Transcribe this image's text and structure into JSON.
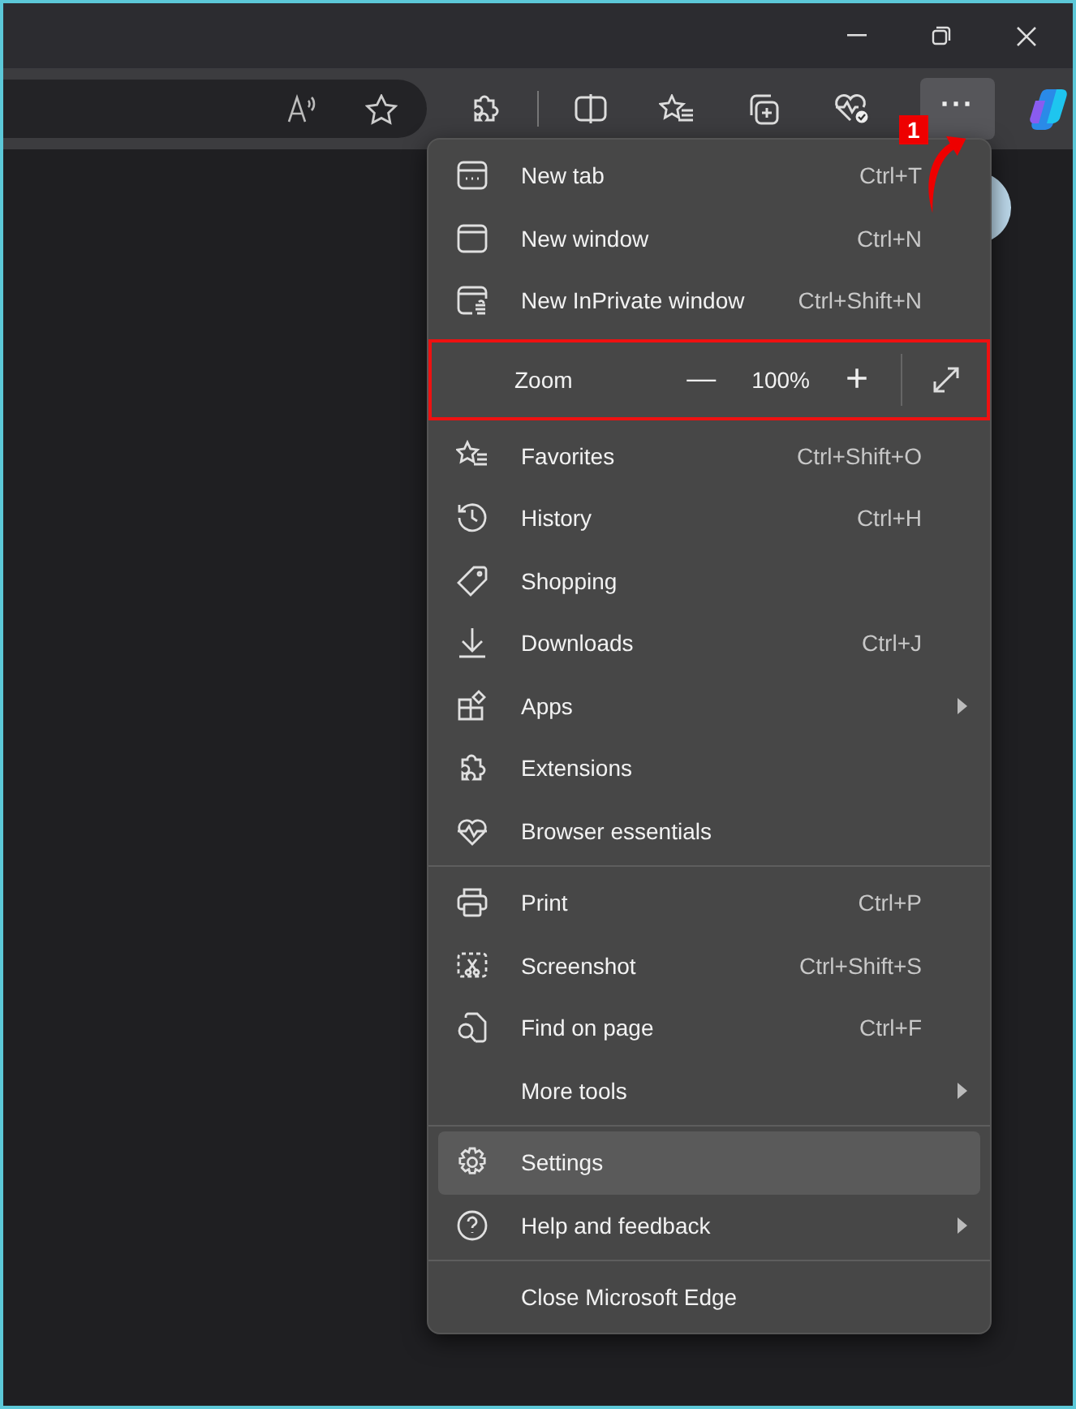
{
  "toolbar": {
    "more_button": {
      "label": "···",
      "active": true
    }
  },
  "menu": {
    "sections": [
      [
        {
          "kind": "item",
          "label": "New tab",
          "shortcut": "Ctrl+T",
          "has_submenu": false,
          "selected": false
        },
        {
          "kind": "item",
          "label": "New window",
          "shortcut": "Ctrl+N",
          "has_submenu": false,
          "selected": false
        },
        {
          "kind": "item",
          "label": "New InPrivate window",
          "shortcut": "Ctrl+Shift+N",
          "has_submenu": false,
          "selected": false
        },
        {
          "kind": "zoom",
          "label": "Zoom",
          "value": "100%",
          "minus": "—",
          "plus": "+",
          "outlined": true
        },
        {
          "kind": "item",
          "label": "Favorites",
          "shortcut": "Ctrl+Shift+O",
          "has_submenu": false,
          "selected": false
        },
        {
          "kind": "item",
          "label": "History",
          "shortcut": "Ctrl+H",
          "has_submenu": false,
          "selected": false
        },
        {
          "kind": "item",
          "label": "Shopping",
          "has_submenu": false,
          "selected": false
        },
        {
          "kind": "item",
          "label": "Downloads",
          "shortcut": "Ctrl+J",
          "has_submenu": false,
          "selected": false
        },
        {
          "kind": "item",
          "label": "Apps",
          "has_submenu": true,
          "selected": false
        },
        {
          "kind": "item",
          "label": "Extensions",
          "has_submenu": false,
          "selected": false
        },
        {
          "kind": "item",
          "label": "Browser essentials",
          "has_submenu": false,
          "selected": false
        }
      ],
      [
        {
          "kind": "item",
          "label": "Print",
          "shortcut": "Ctrl+P",
          "has_submenu": false,
          "selected": false
        },
        {
          "kind": "item",
          "label": "Screenshot",
          "shortcut": "Ctrl+Shift+S",
          "has_submenu": false,
          "selected": false
        },
        {
          "kind": "item",
          "label": "Find on page",
          "shortcut": "Ctrl+F",
          "has_submenu": false,
          "selected": false
        },
        {
          "kind": "item",
          "label": "More tools",
          "has_submenu": true,
          "selected": false
        }
      ],
      [
        {
          "kind": "item",
          "label": "Settings",
          "has_submenu": false,
          "selected": true
        },
        {
          "kind": "item",
          "label": "Help and feedback",
          "has_submenu": true,
          "selected": false
        }
      ],
      [
        {
          "kind": "item",
          "label": "Close Microsoft Edge",
          "has_submenu": false,
          "selected": false
        }
      ]
    ]
  },
  "annotation": {
    "number": "1"
  }
}
